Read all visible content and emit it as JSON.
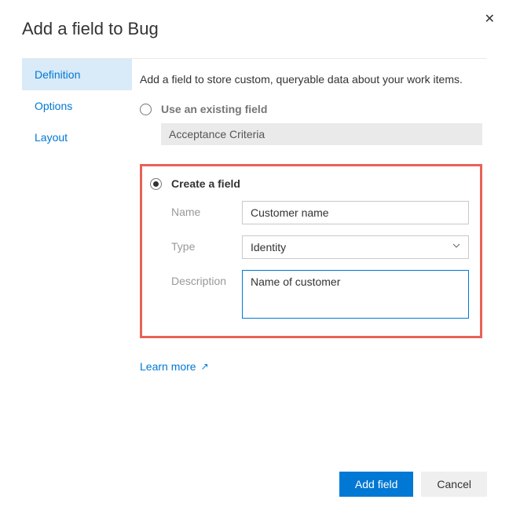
{
  "dialog": {
    "title": "Add a field to Bug",
    "intro": "Add a field to store custom, queryable data about your work items."
  },
  "sidebar": {
    "items": [
      {
        "label": "Definition",
        "active": true
      },
      {
        "label": "Options",
        "active": false
      },
      {
        "label": "Layout",
        "active": false
      }
    ]
  },
  "form": {
    "existing": {
      "label": "Use an existing field",
      "value": "Acceptance Criteria"
    },
    "create": {
      "label": "Create a field",
      "name_label": "Name",
      "name_value": "Customer name",
      "type_label": "Type",
      "type_value": "Identity",
      "desc_label": "Description",
      "desc_value": "Name of customer"
    }
  },
  "links": {
    "learn_more": "Learn more"
  },
  "buttons": {
    "primary": "Add field",
    "secondary": "Cancel"
  }
}
